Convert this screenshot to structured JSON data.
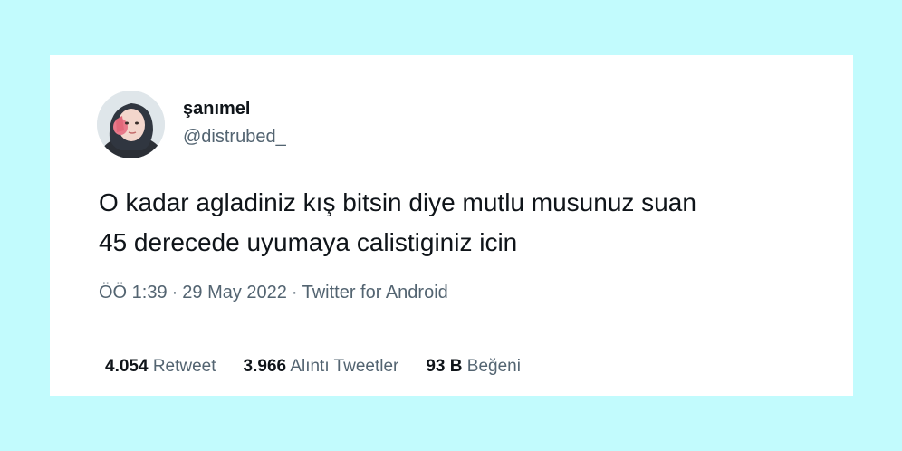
{
  "tweet": {
    "author": {
      "display_name": "şanımel",
      "handle": "@distrubed_",
      "avatar_icon": "profile-photo-icon"
    },
    "text_lines": [
      "O kadar agladiniz kış bitsin diye mutlu musunuz suan",
      "45 derecede uyumaya calistiginiz icin"
    ],
    "meta": {
      "time": "ÖÖ 1:39",
      "separator": "·",
      "date": "29 May 2022",
      "source": "Twitter for Android"
    },
    "stats": [
      {
        "count": "4.054",
        "label": "Retweet"
      },
      {
        "count": "3.966",
        "label": "Alıntı Tweetler"
      },
      {
        "count": "93 B",
        "label": "Beğeni"
      }
    ]
  },
  "colors": {
    "background": "#c2fbfd",
    "card": "#ffffff",
    "primary_text": "#0f1419",
    "secondary_text": "#536471"
  }
}
